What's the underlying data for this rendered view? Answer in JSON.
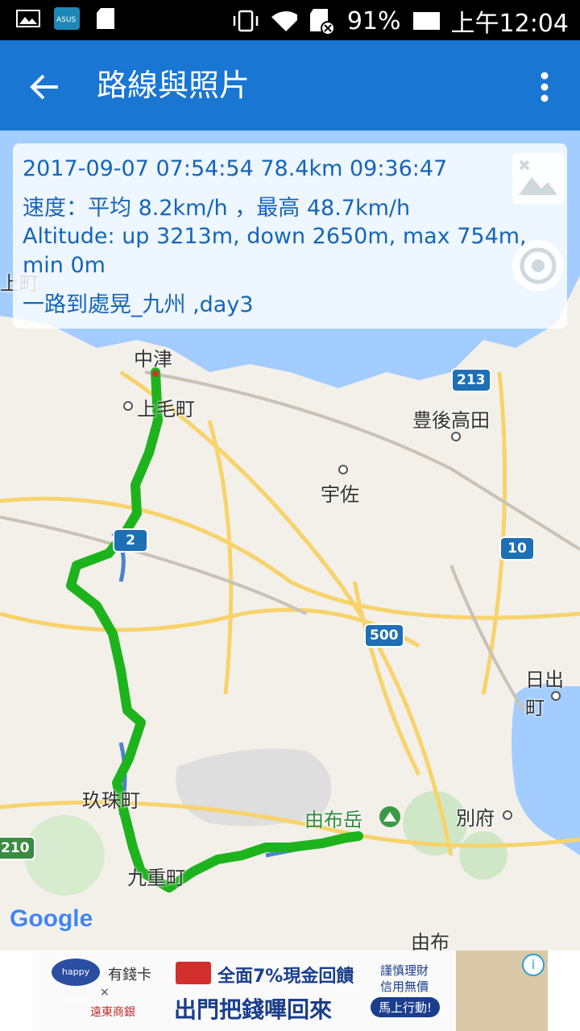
{
  "status_bar": {
    "battery": "91%",
    "time": "上午12:04"
  },
  "app_bar": {
    "title": "路線與照片"
  },
  "info": {
    "line1": "2017-09-07 07:54:54   78.4km   09:36:47",
    "line2": "速度：平均 8.2km/h ，最高 48.7km/h",
    "line3": "Altitude: up 3213m, down 2650m, max 754m,",
    "line4": "min 0m",
    "line5": "一路到處晃_九州 ,day3"
  },
  "map": {
    "places": {
      "nakatsu": "中津",
      "kamike": "上毛町",
      "bungotakada": "豊後高田",
      "usa": "宇佐",
      "hiji": "日出町",
      "kusu": "玖珠町",
      "yufudake": "由布岳",
      "beppu": "別府",
      "kokonoe": "九重町",
      "yufu": "由布",
      "edge_left": "上町"
    },
    "shields": {
      "r213": "213",
      "r10": "10",
      "r500": "500",
      "r210": "210",
      "r212": "2"
    },
    "attribution": "Google",
    "route_color": "#1db31d",
    "water_color": "#a3ccff"
  },
  "ad": {
    "brand": "happy cash",
    "card_text": "有錢卡",
    "bank": "遠東商銀",
    "headline_top": "全面7%現金回饋",
    "headline_bottom": "出門把錢嗶回來",
    "side_text1": "謹慎理財",
    "side_text2": "信用無價",
    "cta": "馬上行動!"
  }
}
